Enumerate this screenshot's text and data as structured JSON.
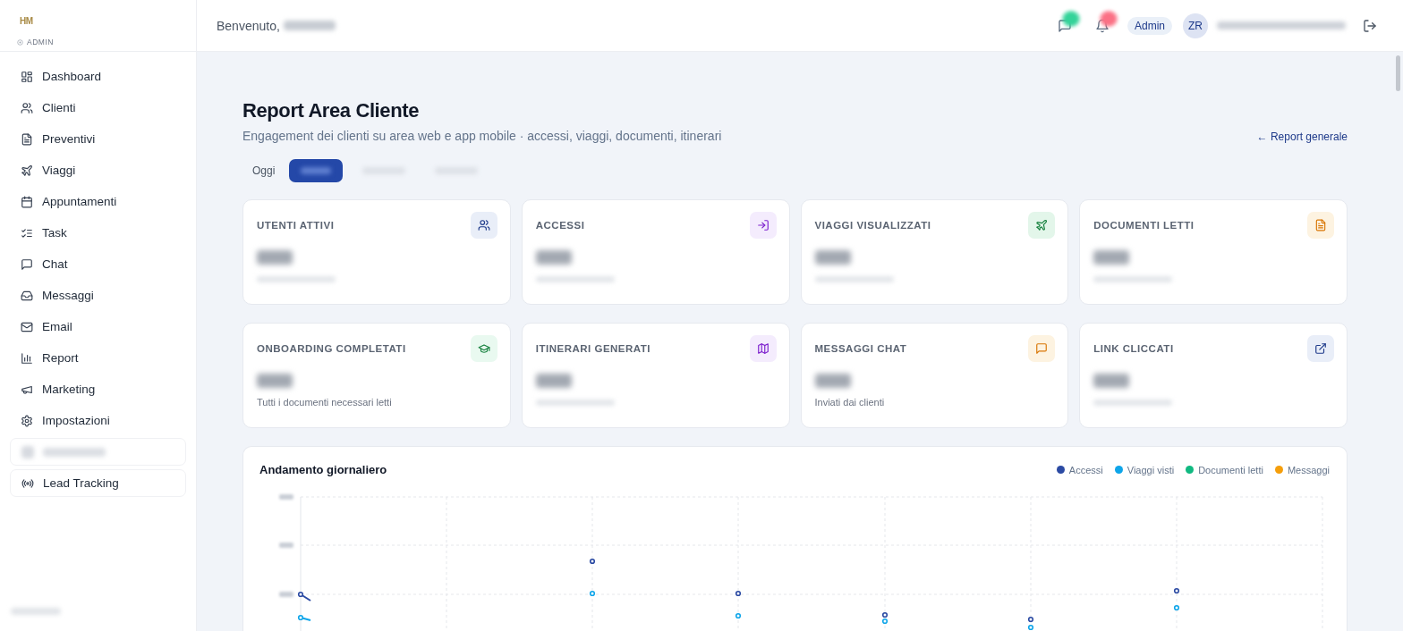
{
  "sidebar": {
    "logo_text": "HM",
    "role_label": "ADMIN",
    "items": [
      {
        "label": "Dashboard",
        "boxed": false
      },
      {
        "label": "Clienti",
        "boxed": false
      },
      {
        "label": "Preventivi",
        "boxed": false
      },
      {
        "label": "Viaggi",
        "boxed": false
      },
      {
        "label": "Appuntamenti",
        "boxed": false
      },
      {
        "label": "Task",
        "boxed": false
      },
      {
        "label": "Chat",
        "boxed": false
      },
      {
        "label": "Messaggi",
        "boxed": false
      },
      {
        "label": "Email",
        "boxed": false
      },
      {
        "label": "Report",
        "boxed": false
      },
      {
        "label": "Marketing",
        "boxed": false
      },
      {
        "label": "Impostazioni",
        "boxed": false
      },
      {
        "hidden": true,
        "boxed": true
      },
      {
        "label": "Lead Tracking",
        "boxed": true
      }
    ],
    "footer_hidden": true
  },
  "header": {
    "greeting": "Benvenuto,",
    "name_hidden": true,
    "actions": [
      {
        "kind": "chat",
        "badge": {
          "color": "#34d399"
        }
      },
      {
        "kind": "bell",
        "badge": {
          "color": "#fb7185"
        }
      }
    ],
    "role_badge": "Admin",
    "avatar_initials": "ZR",
    "email_hidden": true
  },
  "page": {
    "title": "Report Area Cliente",
    "subtitle": "Engagement dei clienti su area web e app mobile · accessi, viaggi, documenti, itinerari",
    "back_link": "← Report generale"
  },
  "tabs": [
    {
      "label": "Oggi",
      "selected": false
    },
    {
      "hidden": true,
      "selected": true
    },
    {
      "hidden": true,
      "selected": false
    },
    {
      "hidden": true,
      "selected": false
    }
  ],
  "cards": [
    {
      "label": "UTENTI ATTIVI",
      "value_hidden": true,
      "note_hidden": true
    },
    {
      "label": "ACCESSI",
      "value_hidden": true,
      "note_hidden": true
    },
    {
      "label": "VIAGGI VISUALIZZATI",
      "value_hidden": true,
      "note_hidden": true
    },
    {
      "label": "DOCUMENTI LETTI",
      "value_hidden": true,
      "note_hidden": true
    },
    {
      "label": "ONBOARDING COMPLETATI",
      "value_hidden": true,
      "note": "Tutti i documenti necessari letti"
    },
    {
      "label": "ITINERARI GENERATI",
      "value_hidden": true,
      "note_hidden": true
    },
    {
      "label": "MESSAGGI CHAT",
      "value_hidden": true,
      "note": "Inviati dai clienti"
    },
    {
      "label": "LINK CLICCATI",
      "value_hidden": true,
      "note_hidden": true
    }
  ],
  "chart": {
    "title": "Andamento giornaliero",
    "legend": [
      {
        "label": "Accessi",
        "color": "#2b4aa3"
      },
      {
        "label": "Viaggi visti",
        "color": "#0ea5e9"
      },
      {
        "label": "Documenti letti",
        "color": "#10b981"
      },
      {
        "label": "Messaggi",
        "color": "#f59e0b"
      }
    ]
  }
}
